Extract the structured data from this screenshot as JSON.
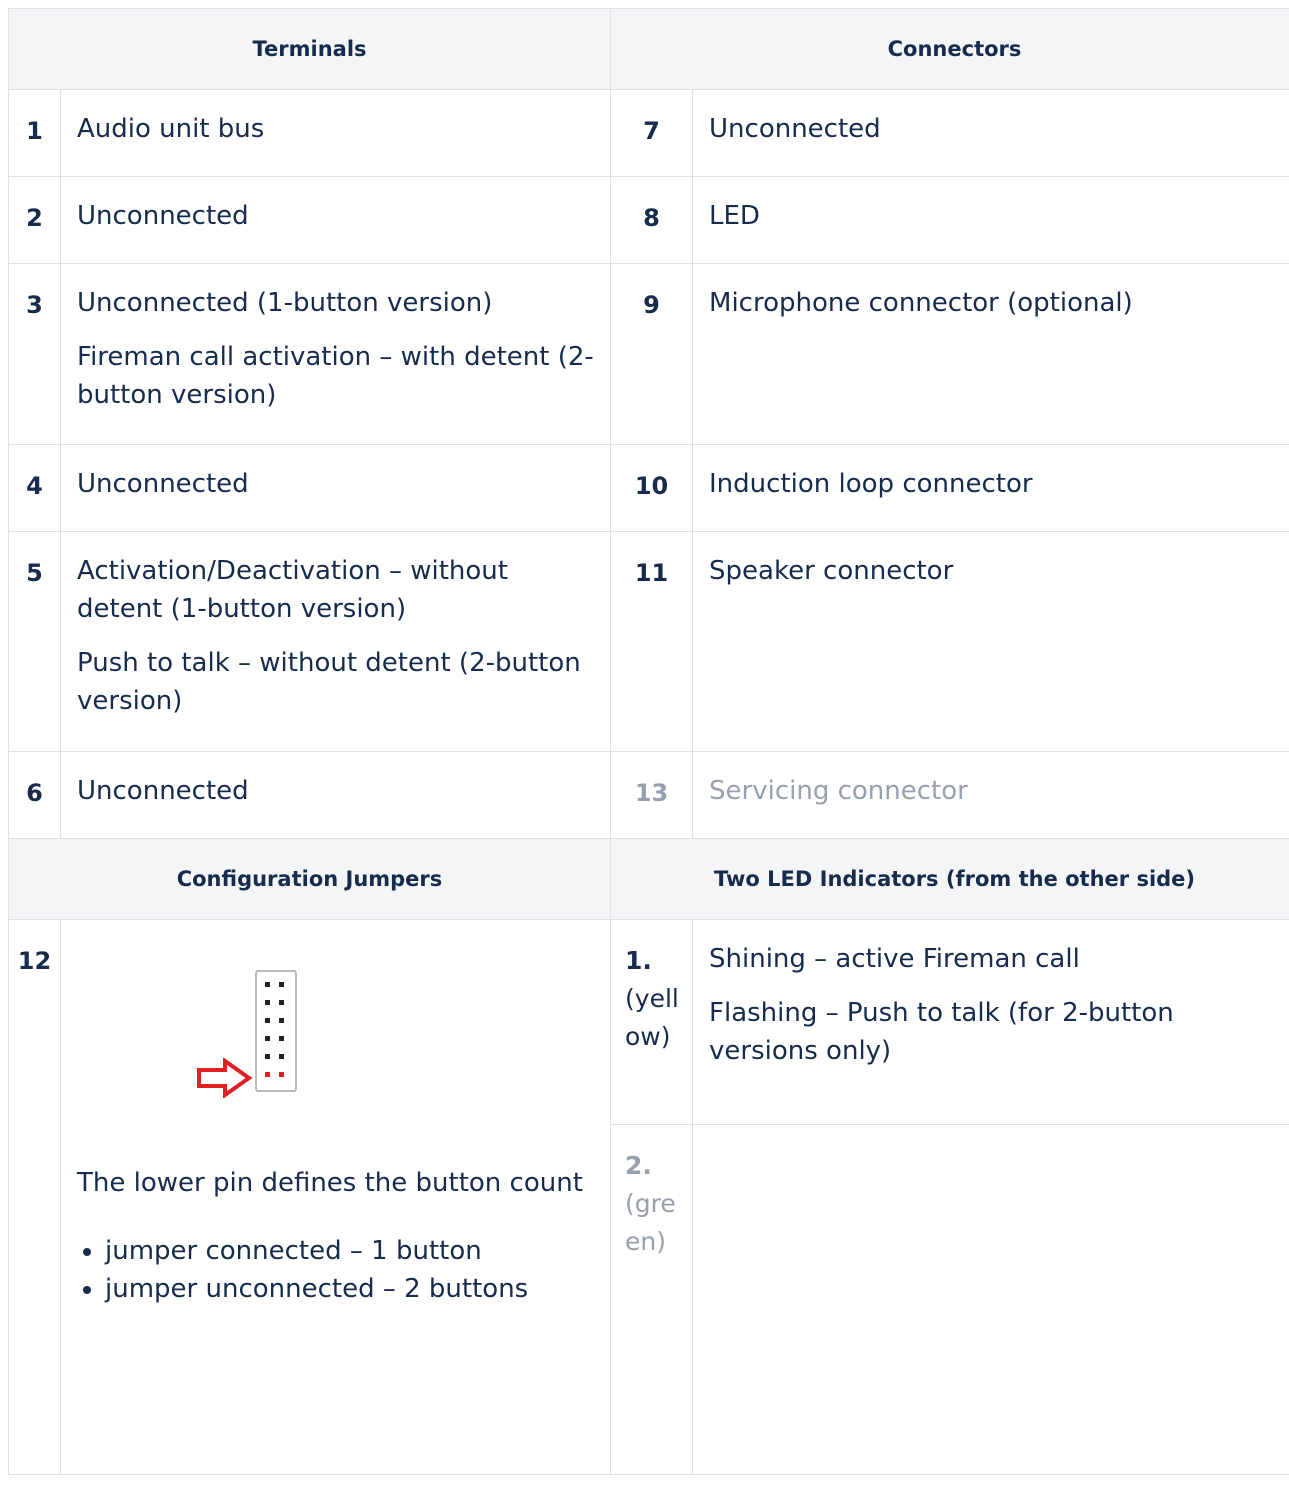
{
  "headers": {
    "terminals": "Terminals",
    "connectors": "Connectors",
    "config_jumpers": "Configuration Jumpers",
    "led_indicators": "Two LED Indicators (from the other side)"
  },
  "rows": [
    {
      "t_num": "1",
      "t_lines": [
        "Audio unit bus"
      ],
      "c_num": "7",
      "c_text": "Unconnected"
    },
    {
      "t_num": "2",
      "t_lines": [
        "Unconnected"
      ],
      "c_num": "8",
      "c_text": "LED"
    },
    {
      "t_num": "3",
      "t_lines": [
        "Unconnected (1-button version)",
        "Fireman call activation – with detent (2-button version)"
      ],
      "c_num": "9",
      "c_text": "Microphone connector (optional)"
    },
    {
      "t_num": "4",
      "t_lines": [
        "Unconnected"
      ],
      "c_num": "10",
      "c_text": "Induction loop connector"
    },
    {
      "t_num": "5",
      "t_lines": [
        "Activation/Deactivation – without detent (1-button version)",
        "Push to talk – without detent (2-button version)"
      ],
      "c_num": "11",
      "c_text": "Speaker connector"
    },
    {
      "t_num": "6",
      "t_lines": [
        "Unconnected"
      ],
      "c_num": "13",
      "c_text": "Servicing connector"
    }
  ],
  "jumper": {
    "num": "12",
    "description": "The lower pin defines the button count",
    "bullets": [
      "jumper connected – 1 button",
      "jumper unconnected – 2 buttons"
    ]
  },
  "leds": [
    {
      "num": "1.",
      "color": "(yellow)",
      "lines": [
        "Shining – active Fireman call",
        "Flashing – Push to talk (for 2-button versions only)"
      ]
    },
    {
      "num": "2.",
      "color": "(green)",
      "lines": []
    }
  ],
  "colors": {
    "header_bg": "#f4f5f7",
    "border": "#dfe1e6",
    "text": "#172b4d",
    "muted": "#97a0af",
    "arrow": "#e02020"
  }
}
